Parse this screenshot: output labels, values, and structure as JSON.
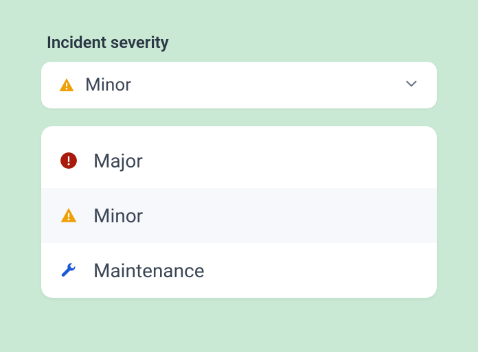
{
  "field": {
    "label": "Incident severity",
    "selected_icon": "warning-triangle",
    "selected_value": "Minor"
  },
  "options": [
    {
      "icon": "error-circle",
      "label": "Major",
      "selected": false
    },
    {
      "icon": "warning-triangle",
      "label": "Minor",
      "selected": true
    },
    {
      "icon": "wrench",
      "label": "Maintenance",
      "selected": false
    }
  ],
  "colors": {
    "major": "#a81b0c",
    "minor": "#efa007",
    "maintenance": "#1b58d6"
  }
}
